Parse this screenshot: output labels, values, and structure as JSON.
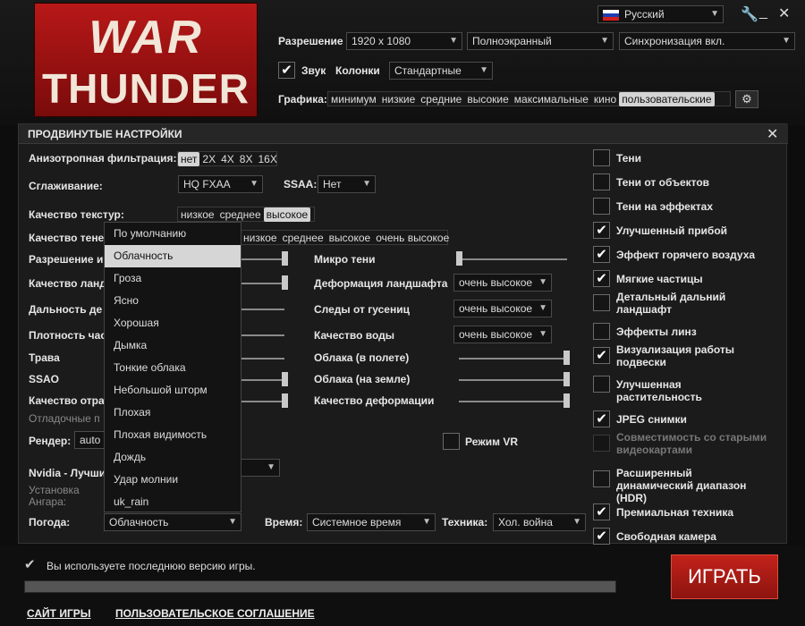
{
  "logo": {
    "line1": "WAR",
    "line2": "THUNDER"
  },
  "header": {
    "language": "Русский",
    "resolution_label": "Разрешение",
    "resolution": "1920 x 1080",
    "mode": "Полноэкранный",
    "vsync": "Синхронизация вкл.",
    "sound_label": "Звук",
    "speakers_label": "Колонки",
    "speakers": "Стандартные",
    "graphics_label": "Графика:",
    "graphics_presets": [
      "минимум",
      "низкие",
      "средние",
      "высокие",
      "максимальные",
      "кино",
      "пользовательские"
    ],
    "graphics_selected": 6
  },
  "panel": {
    "title": "ПРОДВИНУТЫЕ НАСТРОЙКИ",
    "aniso_label": "Анизотропная фильтрация:",
    "aniso_options": [
      "нет",
      "2X",
      "4X",
      "8X",
      "16X"
    ],
    "aa_label": "Сглаживание:",
    "aa_value": "HQ FXAA",
    "ssaa_label": "SSAA:",
    "ssaa_value": "Нет",
    "texture_label": "Качество текстур:",
    "texture_options": [
      "низкое",
      "среднее",
      "высокое"
    ],
    "shadow_label": "Качество тене",
    "shadow_options": [
      "низкое",
      "среднее",
      "высокое",
      "очень высокое"
    ],
    "left_labels": [
      "Разрешение и",
      "Качество ланд",
      "Дальность де",
      "Плотность час",
      "Трава",
      "SSAO",
      "Качество отра"
    ],
    "debug_label": "Отладочные п",
    "render_label": "Рендер:",
    "render_value": "auto",
    "nvidia_label": "Nvidia - Лучши",
    "install_label": "Установка",
    "ansel_label": "Ангара:",
    "micro_shadows": "Микро тени",
    "terrain_deform_label": "Деформация ландшафта",
    "terrain_deform_value": "очень высокое",
    "tracks_label": "Следы от гусениц",
    "tracks_value": "очень высокое",
    "water_label": "Качество воды",
    "water_value": "очень высокое",
    "clouds_flight": "Облака (в полете)",
    "clouds_ground": "Облака (на земле)",
    "deform_quality": "Качество деформации",
    "vr_label": "Режим VR",
    "weather_label": "Погода:",
    "weather_value": "Облачность",
    "time_label": "Время:",
    "time_value": "Системное время",
    "tech_label": "Техника:",
    "tech_value": "Хол. война",
    "weather_options": [
      "По умолчанию",
      "Облачность",
      "Гроза",
      "Ясно",
      "Хорошая",
      "Дымка",
      "Тонкие облака",
      "Небольшой шторм",
      "Плохая",
      "Плохая видимость",
      "Дождь",
      "Удар молнии",
      "uk_rain"
    ],
    "weather_highlight": 1
  },
  "checks": [
    {
      "label": "Тени",
      "checked": false,
      "disabled": false
    },
    {
      "label": "Тени от объектов",
      "checked": false,
      "disabled": false
    },
    {
      "label": "Тени на эффектах",
      "checked": false,
      "disabled": false
    },
    {
      "label": "Улучшенный прибой",
      "checked": true,
      "disabled": false
    },
    {
      "label": "Эффект горячего воздуха",
      "checked": true,
      "disabled": false
    },
    {
      "label": "Мягкие частицы",
      "checked": true,
      "disabled": false
    },
    {
      "label": "Детальный дальний ландшафт",
      "checked": false,
      "disabled": false
    },
    {
      "label": "Эффекты линз",
      "checked": false,
      "disabled": false
    },
    {
      "label": "Визуализация работы подвески",
      "checked": true,
      "disabled": false
    },
    {
      "label": "Улучшенная растительность",
      "checked": false,
      "disabled": false
    },
    {
      "label": "JPEG снимки",
      "checked": true,
      "disabled": false
    },
    {
      "label": "Совместимость со старыми видеокартами",
      "checked": false,
      "disabled": true
    },
    {
      "label": "Расширенный динамический диапазон (HDR)",
      "checked": false,
      "disabled": false
    },
    {
      "label": "Премиальная техника",
      "checked": true,
      "disabled": false
    },
    {
      "label": "Свободная камера",
      "checked": true,
      "disabled": false
    }
  ],
  "footer": {
    "status": "Вы используете последнюю версию игры.",
    "play": "ИГРАТЬ",
    "site_link": "САЙТ ИГРЫ",
    "agreement_link": "ПОЛЬЗОВАТЕЛЬСКОЕ СОГЛАШЕНИЕ"
  },
  "colors": {
    "accent": "#b81818",
    "play": "#c3221a"
  }
}
